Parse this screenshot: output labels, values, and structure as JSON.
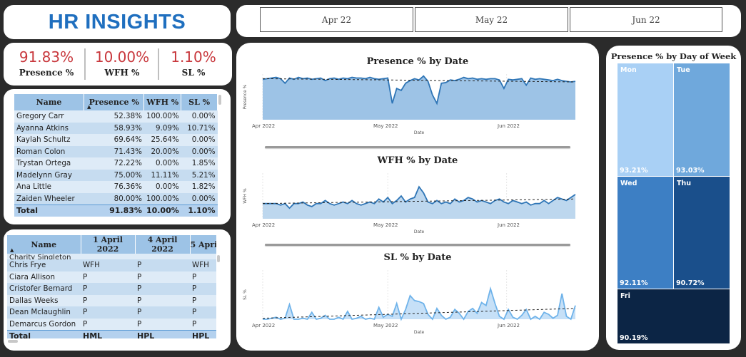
{
  "title": "HR INSIGHTS",
  "months": [
    "Apr 22",
    "May 22",
    "Jun 22"
  ],
  "kpis": [
    {
      "value": "91.83%",
      "label": "Presence %"
    },
    {
      "value": "10.00%",
      "label": "WFH %"
    },
    {
      "value": "1.10%",
      "label": "SL %"
    }
  ],
  "employee_table": {
    "headers": [
      "Name",
      "Presence %",
      "WFH %",
      "SL %"
    ],
    "rows": [
      [
        "Gregory Carr",
        "52.38%",
        "100.00%",
        "0.00%"
      ],
      [
        "Ayanna Atkins",
        "58.93%",
        "9.09%",
        "10.71%"
      ],
      [
        "Kaylah Schultz",
        "69.64%",
        "25.64%",
        "0.00%"
      ],
      [
        "Roman Colon",
        "71.43%",
        "20.00%",
        "0.00%"
      ],
      [
        "Trystan Ortega",
        "72.22%",
        "0.00%",
        "1.85%"
      ],
      [
        "Madelynn Gray",
        "75.00%",
        "11.11%",
        "5.21%"
      ],
      [
        "Ana Little",
        "76.36%",
        "0.00%",
        "1.82%"
      ],
      [
        "Zaiden Wheeler",
        "80.00%",
        "100.00%",
        "0.00%"
      ]
    ],
    "total": [
      "Total",
      "91.83%",
      "10.00%",
      "1.10%"
    ]
  },
  "attendance_table": {
    "headers": [
      "Name",
      "1 April 2022",
      "4 April 2022",
      "5 Apri"
    ],
    "partial_row": [
      "Charity Singleton"
    ],
    "rows": [
      [
        "Chris Frye",
        "WFH",
        "P",
        "WFH"
      ],
      [
        "Ciara Allison",
        "P",
        "P",
        "P"
      ],
      [
        "Cristofer Bernard",
        "P",
        "P",
        "P"
      ],
      [
        "Dallas Weeks",
        "P",
        "P",
        "P"
      ],
      [
        "Dean Mclaughlin",
        "P",
        "P",
        "P"
      ],
      [
        "Demarcus Gordon",
        "P",
        "P",
        "P"
      ]
    ],
    "total": [
      "Total",
      "HML",
      "HPL",
      "HPL"
    ]
  },
  "chart_data": [
    {
      "type": "area",
      "title": "Presence % by Date",
      "ylabel": "Presence %",
      "xlabel": "Date",
      "x_ticks": [
        "Apr 2022",
        "May 2022",
        "Jun 2022"
      ],
      "ylim": [
        0.3,
        1.0
      ],
      "values": [
        0.92,
        0.93,
        0.94,
        0.95,
        0.93,
        0.86,
        0.94,
        0.92,
        0.95,
        0.93,
        0.94,
        0.92,
        0.93,
        0.94,
        0.9,
        0.93,
        0.94,
        0.92,
        0.94,
        0.93,
        0.95,
        0.94,
        0.94,
        0.93,
        0.95,
        0.93,
        0.92,
        0.93,
        0.94,
        0.55,
        0.78,
        0.75,
        0.86,
        0.9,
        0.93,
        0.91,
        0.97,
        0.89,
        0.68,
        0.55,
        0.86,
        0.87,
        0.91,
        0.9,
        0.92,
        0.95,
        0.93,
        0.94,
        0.92,
        0.93,
        0.92,
        0.93,
        0.93,
        0.91,
        0.78,
        0.92,
        0.91,
        0.92,
        0.93,
        0.83,
        0.94,
        0.92,
        0.93,
        0.92,
        0.91,
        0.9,
        0.92,
        0.9,
        0.89,
        0.88,
        0.89
      ],
      "trend": [
        0.93,
        0.88
      ]
    },
    {
      "type": "area",
      "title": "WFH % by Date",
      "ylabel": "WFH %",
      "xlabel": "Date",
      "x_ticks": [
        "Apr 2022",
        "May 2022",
        "Jun 2022"
      ],
      "ylim": [
        0,
        0.3
      ],
      "values": [
        0.1,
        0.1,
        0.1,
        0.1,
        0.09,
        0.1,
        0.07,
        0.1,
        0.1,
        0.11,
        0.09,
        0.08,
        0.1,
        0.1,
        0.12,
        0.1,
        0.09,
        0.1,
        0.11,
        0.1,
        0.12,
        0.1,
        0.09,
        0.1,
        0.11,
        0.1,
        0.13,
        0.11,
        0.14,
        0.1,
        0.12,
        0.15,
        0.11,
        0.13,
        0.14,
        0.21,
        0.17,
        0.11,
        0.1,
        0.12,
        0.1,
        0.11,
        0.1,
        0.13,
        0.11,
        0.12,
        0.14,
        0.13,
        0.11,
        0.12,
        0.11,
        0.1,
        0.12,
        0.13,
        0.11,
        0.1,
        0.12,
        0.11,
        0.1,
        0.11,
        0.09,
        0.1,
        0.1,
        0.12,
        0.1,
        0.12,
        0.14,
        0.13,
        0.12,
        0.14,
        0.16
      ],
      "trend": [
        0.1,
        0.13
      ]
    },
    {
      "type": "area",
      "title": "SL % by Date",
      "ylabel": "SL %",
      "xlabel": "Date",
      "x_ticks": [
        "Apr 2022",
        "May 2022",
        "Jun 2022"
      ],
      "ylim": [
        0,
        0.05
      ],
      "values": [
        0.0,
        0.0,
        0.001,
        0.002,
        0.0,
        0.001,
        0.015,
        0.0,
        0.0,
        0.001,
        0.0,
        0.007,
        0.0,
        0.001,
        0.004,
        0.0,
        0.0,
        0.002,
        0.0,
        0.008,
        0.0,
        0.001,
        0.003,
        0.0,
        0.001,
        0.0,
        0.012,
        0.002,
        0.005,
        0.003,
        0.016,
        0.0,
        0.01,
        0.024,
        0.019,
        0.018,
        0.016,
        0.005,
        0.0,
        0.011,
        0.004,
        0.0,
        0.002,
        0.01,
        0.006,
        0.0,
        0.008,
        0.011,
        0.006,
        0.017,
        0.014,
        0.031,
        0.016,
        0.003,
        0.0,
        0.01,
        0.002,
        0.0,
        0.004,
        0.01,
        0.0,
        0.003,
        0.0,
        0.007,
        0.005,
        0.001,
        0.004,
        0.026,
        0.003,
        0.0,
        0.014
      ],
      "trend": [
        0.001,
        0.011
      ]
    },
    {
      "type": "heatmap",
      "title": "Presence % by Day of Week",
      "categories": [
        "Mon",
        "Tue",
        "Wed",
        "Thu",
        "Fri"
      ],
      "values": [
        93.21,
        93.03,
        92.11,
        90.72,
        90.19
      ],
      "labels": [
        "93.21%",
        "93.03%",
        "92.11%",
        "90.72%",
        "90.19%"
      ],
      "colors": [
        "#a9d0f5",
        "#6fa8dc",
        "#3d7fc4",
        "#1a4f8b",
        "#0c2545"
      ]
    }
  ],
  "colors": {
    "title_blue": "#1f6fbf",
    "kpi_red": "#c8373c",
    "header_blue": "#9dc3e6",
    "line_blue": "#2e75b6",
    "area_blue": "#9dc3e6"
  }
}
